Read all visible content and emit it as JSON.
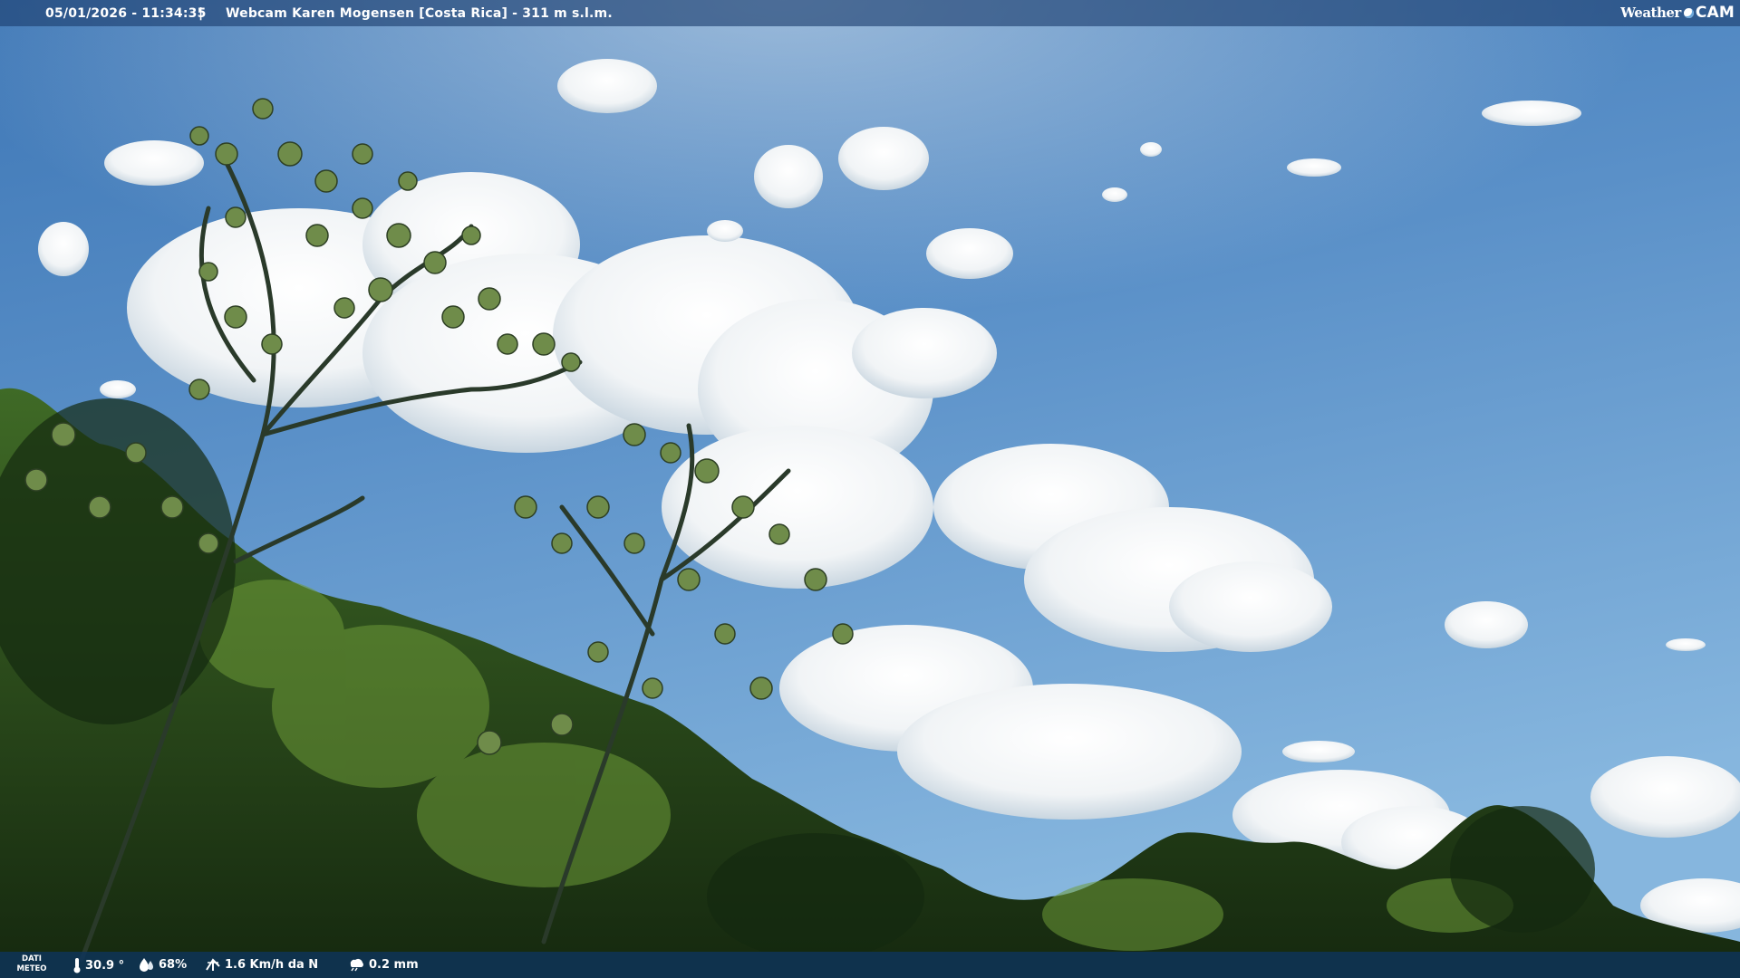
{
  "header": {
    "datetime": "05/01/2026 - 11:34:35",
    "separator": "|",
    "title": "Webcam Karen Mogensen [Costa Rica]  - 311 m s.l.m."
  },
  "logo": {
    "weather": "Weather",
    "cam": "CAM"
  },
  "weather_bar": {
    "label_line1": "DATI",
    "label_line2": "METEO",
    "temperature": "30.9 °",
    "humidity": "68%",
    "wind": "1.6 Km/h da N",
    "rain": "0.2 mm"
  },
  "icons": {
    "temperature": "thermometer-icon",
    "humidity": "water-drop-icon",
    "wind": "wind-icon",
    "rain": "rain-cloud-icon"
  },
  "colors": {
    "sky_top": "#3c74b4",
    "sky_bottom": "#7fb0dc",
    "foliage_dark": "#1d3a1c",
    "foliage_light": "#5f8f2e",
    "bar_bg": "#1c3e6e"
  }
}
